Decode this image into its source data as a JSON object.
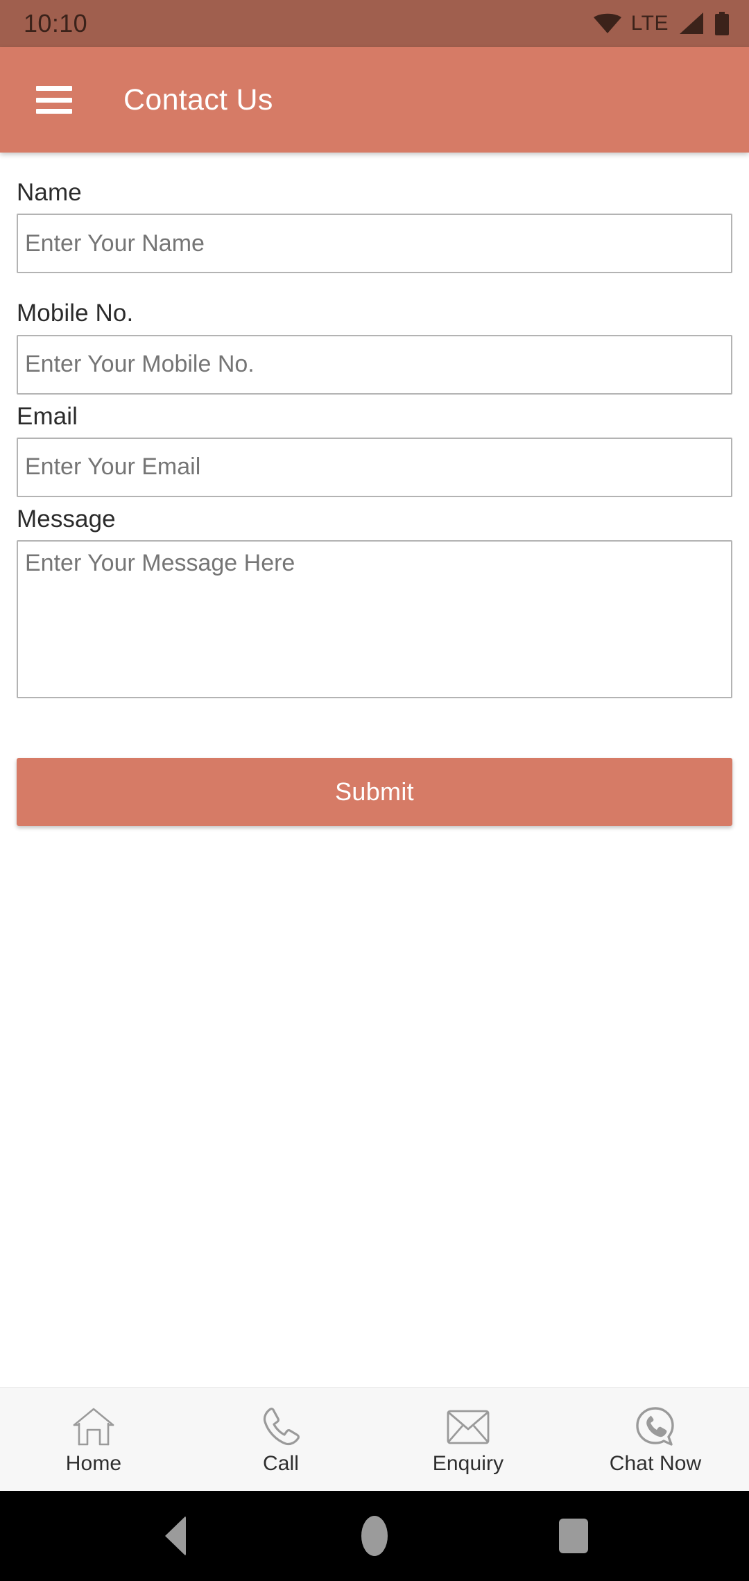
{
  "status_bar": {
    "time": "10:10",
    "network_label": "LTE",
    "icons": [
      "wifi-icon",
      "signal-icon",
      "battery-icon"
    ],
    "background_color": "#A05F4E",
    "text_color": "#3B221A"
  },
  "app_bar": {
    "menu_icon": "hamburger-menu-icon",
    "title": "Contact Us",
    "background_color": "#D67B66",
    "title_color": "#FFFFFF"
  },
  "form": {
    "fields": [
      {
        "label": "Name",
        "placeholder": "Enter Your Name",
        "value": "",
        "type": "text"
      },
      {
        "label": "Mobile No.",
        "placeholder": "Enter Your Mobile No.",
        "value": "",
        "type": "tel"
      },
      {
        "label": "Email",
        "placeholder": "Enter Your Email",
        "value": "",
        "type": "email"
      },
      {
        "label": "Message",
        "placeholder": "Enter Your Message Here",
        "value": "",
        "type": "textarea"
      }
    ],
    "submit_label": "Submit",
    "submit_color": "#D67B66",
    "input_border_color": "#B3B3B3",
    "placeholder_color": "#555555"
  },
  "bottom_nav": {
    "background_color": "#F7F7F7",
    "items": [
      {
        "label": "Home",
        "icon": "home-icon"
      },
      {
        "label": "Call",
        "icon": "phone-icon"
      },
      {
        "label": "Enquiry",
        "icon": "envelope-icon"
      },
      {
        "label": "Chat Now",
        "icon": "whatsapp-chat-icon"
      }
    ]
  },
  "system_nav": {
    "background_color": "#000000",
    "buttons": [
      "back-button",
      "home-button",
      "recents-button"
    ]
  }
}
